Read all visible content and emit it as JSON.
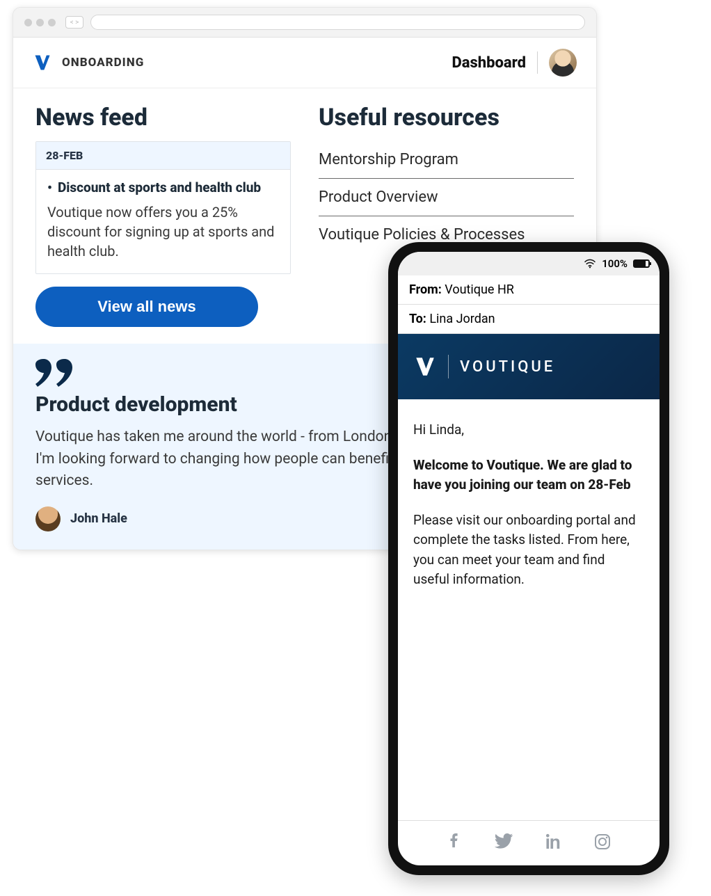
{
  "browser": {
    "brand_word": "ONBOARDING",
    "dashboard_label": "Dashboard"
  },
  "news": {
    "heading": "News feed",
    "date": "28-FEB",
    "title": "Discount at sports and health club",
    "body": "Voutique now offers you a 25% discount for signing up at sports and health club.",
    "view_all_label": "View all news"
  },
  "resources": {
    "heading": "Useful resources",
    "items": [
      "Mentorship Program",
      "Product Overview",
      "Voutique Policies & Processes"
    ]
  },
  "quote": {
    "title": "Product development",
    "body": "Voutique has taken me around the world - from London to New Zealand. Every day, I'm looking forward to changing how people can benefit from our products and services.",
    "author": "John Hale"
  },
  "phone": {
    "battery_text": "100%",
    "from_label": "From:",
    "from_value": "Voutique HR",
    "to_label": "To:",
    "to_value": "Lina Jordan",
    "banner_title": "VOUTIQUE",
    "greeting": "Hi Linda,",
    "welcome": "Welcome to Voutique. We are glad to have you joining our team on 28-Feb",
    "paragraph": "Please visit our onboarding portal and complete the tasks listed. From here, you can meet your team and find useful information."
  }
}
